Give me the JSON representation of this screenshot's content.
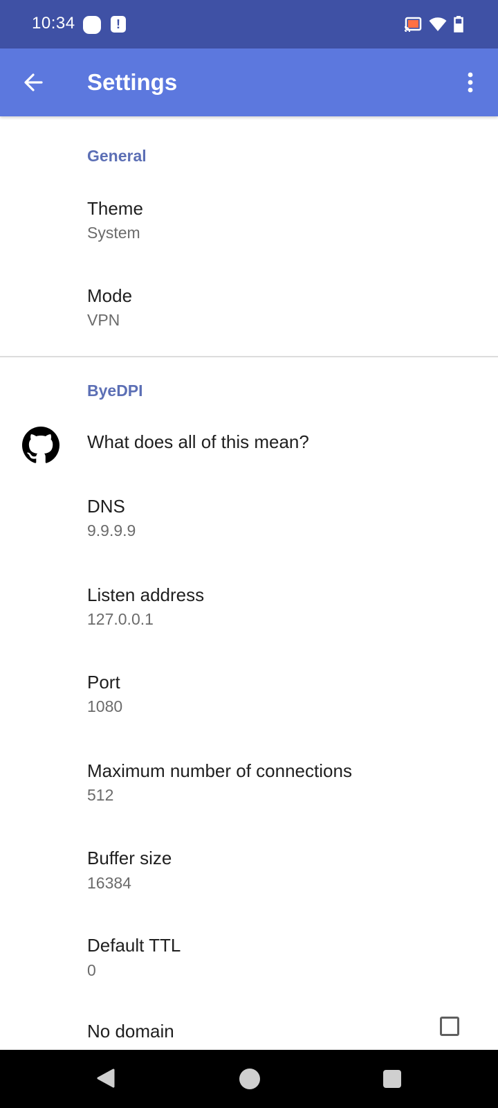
{
  "status_bar": {
    "time": "10:34",
    "icons": [
      "notification-icon",
      "alert-notification-icon",
      "cast-icon",
      "wifi-icon",
      "battery-icon"
    ]
  },
  "app_bar": {
    "title": "Settings",
    "back_icon": "arrow-back-icon",
    "menu_icon": "more-vert-icon"
  },
  "sections": {
    "general": {
      "header": "General",
      "theme": {
        "title": "Theme",
        "summary": "System"
      },
      "mode": {
        "title": "Mode",
        "summary": "VPN"
      }
    },
    "byedpi": {
      "header": "ByeDPI",
      "help": {
        "title": "What does all of this mean?",
        "icon": "github-icon"
      },
      "dns": {
        "title": "DNS",
        "summary": "9.9.9.9"
      },
      "listen_address": {
        "title": "Listen address",
        "summary": "127.0.0.1"
      },
      "port": {
        "title": "Port",
        "summary": "1080"
      },
      "max_connections": {
        "title": "Maximum number of connections",
        "summary": "512"
      },
      "buffer_size": {
        "title": "Buffer size",
        "summary": "16384"
      },
      "default_ttl": {
        "title": "Default TTL",
        "summary": "0"
      },
      "no_domain": {
        "title": "No domain",
        "checked": false
      }
    }
  },
  "colors": {
    "status_bar": "#3f51a5",
    "app_bar": "#5c78de",
    "accent": "#5c6fb5"
  },
  "nav_bar": {
    "icons": [
      "nav-back-icon",
      "nav-home-icon",
      "nav-recents-icon"
    ]
  }
}
